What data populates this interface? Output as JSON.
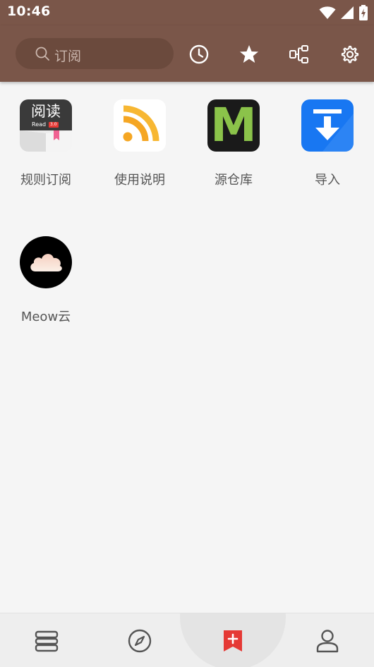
{
  "status_bar": {
    "time": "10:46",
    "icons": [
      "wifi-icon",
      "signal-icon",
      "battery-charging-icon"
    ]
  },
  "toolbar": {
    "search_placeholder": "订阅",
    "actions": [
      "history-icon",
      "star-icon",
      "group-icon",
      "settings-icon"
    ]
  },
  "colors": {
    "primary": "#7a5649",
    "search_bg": "#6b4a3d",
    "active_nav": "#e53935",
    "background": "#f5f5f5"
  },
  "items": [
    {
      "label": "规则订阅",
      "icon": "yuedu-app-icon",
      "icon_text": "阅读",
      "icon_subtext": "Read",
      "icon_badge": "3.0"
    },
    {
      "label": "使用说明",
      "icon": "rss-icon"
    },
    {
      "label": "源仓库",
      "icon": "m-logo-icon",
      "icon_text": "M"
    },
    {
      "label": "导入",
      "icon": "download-icon"
    },
    {
      "label": "Meow云",
      "icon": "cloud-icon"
    }
  ],
  "bottom_nav": [
    {
      "name": "bookshelf",
      "icon": "bookshelf-icon",
      "active": false
    },
    {
      "name": "discover",
      "icon": "compass-icon",
      "active": false
    },
    {
      "name": "subscription",
      "icon": "bookmark-add-icon",
      "active": true
    },
    {
      "name": "my",
      "icon": "person-icon",
      "active": false
    }
  ]
}
